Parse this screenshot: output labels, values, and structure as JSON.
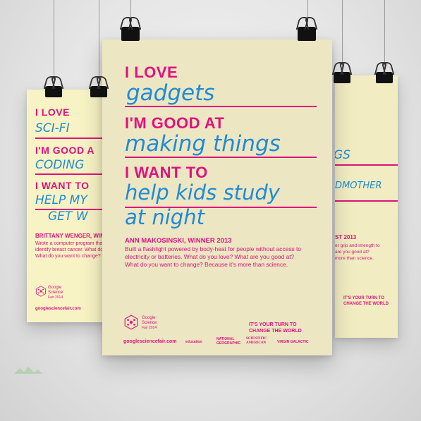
{
  "center": {
    "love_label": "I LOVE",
    "love_value": "gadgets",
    "good_label": "I'M GOOD AT",
    "good_value": "making things",
    "want_label": "I WANT TO",
    "want_value_1": "help kids study",
    "want_value_2": "at night",
    "winner": "ANN MAKOSINSKI, WINNER 2013",
    "body_1": "Built a flashlight powered by body-heat for people without access to",
    "body_2": "electricity or batteries. What do you love? What are you good at?",
    "body_3": "What do you want to change? Because it's more than science.",
    "logo_1": "Google",
    "logo_2": "Science",
    "logo_3": "Fair 2014",
    "turn_1": "IT'S YOUR TURN TO",
    "turn_2": "CHANGE THE WORLD",
    "url": "googlesciencefair.com",
    "sponsors": [
      "education",
      "NATIONAL GEOGRAPHIC",
      "SCIENTIFIC AMERICAN",
      "VIRGIN GALACTIC"
    ]
  },
  "left": {
    "love_label": "I LOVE",
    "love_value": "SCI-FI",
    "good_label": "I'M GOOD A",
    "good_value": "CODING",
    "want_label": "I WANT TO",
    "want_value_1": "HELP MY",
    "want_value_2": "GET W",
    "winner": "BRITTANY WENGER, WINN",
    "body_1": "Wrote a computer program tha",
    "body_2": "identify breast cancer. What do",
    "body_3": "What do you want to change?",
    "logo_1": "Google",
    "logo_2": "Science",
    "logo_3": "Fair 2014",
    "url": "googlesciencefair.com"
  },
  "right": {
    "good_value": "GS",
    "want_value": "DMOTHER",
    "winner": "ST 2013",
    "body_1": "er grip and strength to",
    "body_2": "are you good at?",
    "body_3": "more than science.",
    "turn_1": "IT'S YOUR TURN TO",
    "turn_2": "CHANGE THE WORLD"
  },
  "colors": {
    "pink": "#e0127b",
    "blue": "#1e8bd6",
    "paper": "#ede6c3"
  }
}
